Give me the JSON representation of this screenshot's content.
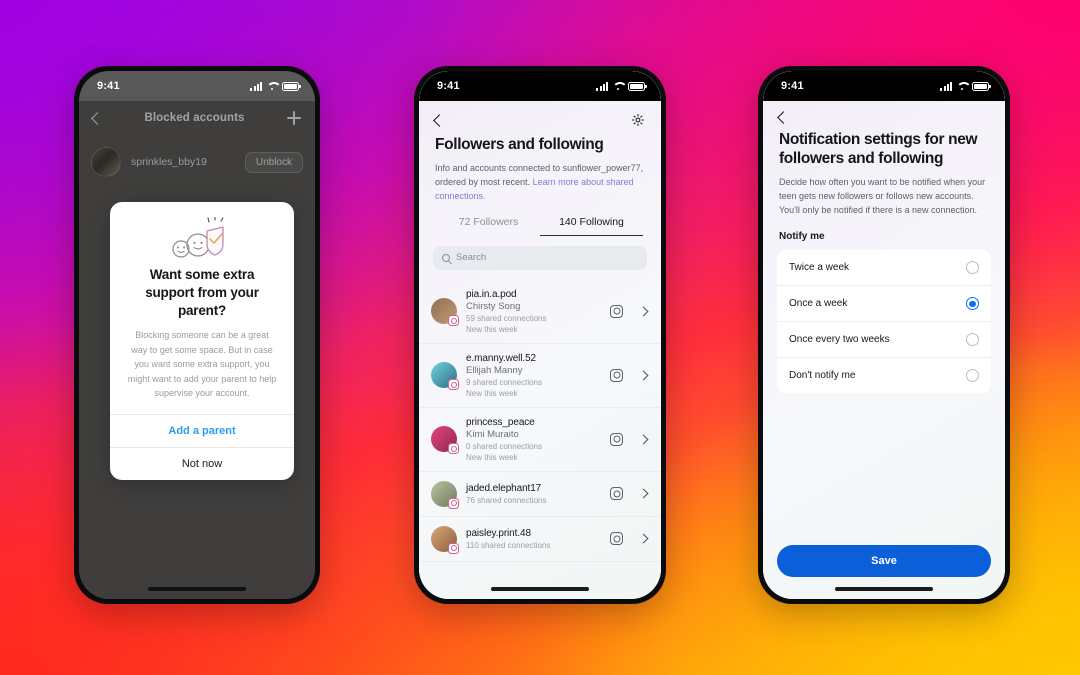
{
  "background": {
    "gradient_colors": [
      "#9b13e0",
      "#d5119b",
      "#ff2d3d",
      "#ff7a16",
      "#ffc400"
    ]
  },
  "accent": {
    "instagram_blue": "#0b5fd9",
    "link_blue": "#2b9cf0",
    "lavender_link": "#7b7fd1"
  },
  "phones": [
    {
      "id": "blocked-accounts",
      "status_bar": {
        "time": "9:41"
      },
      "nav": {
        "back": "back-chevron",
        "title": "Blocked accounts",
        "add": "plus-icon"
      },
      "blocked_row": {
        "username": "sprinkles_bby19",
        "action_label": "Unblock"
      },
      "dialog": {
        "illustration": "faces-with-shield-illustration",
        "heading": "Want some extra support from your parent?",
        "body": "Blocking someone can be a great way to get some space. But in case you want some extra support, you might want to add your parent to help supervise your account.",
        "primary_label": "Add a parent",
        "secondary_label": "Not now"
      }
    },
    {
      "id": "followers-and-following",
      "status_bar": {
        "time": "9:41"
      },
      "topbar": {
        "back": "back-chevron",
        "settings": "gear-icon"
      },
      "title": "Followers and following",
      "subtitle": "Info and accounts connected to sunflower_power77, ordered by most recent.",
      "link": "Learn more about shared connections.",
      "tabs": [
        {
          "label": "72 Followers",
          "active": false
        },
        {
          "label": "140 Following",
          "active": true
        }
      ],
      "search": {
        "placeholder": "Search"
      },
      "accounts": [
        {
          "username": "pia.in.a.pod",
          "name": "Chirsty Song",
          "connections": "59 shared connections",
          "note": "New this week",
          "avatar_colors": [
            "#8f6f52",
            "#c49a78"
          ]
        },
        {
          "username": "e.manny.well.52",
          "name": "Ellijah Manny",
          "connections": "9 shared connections",
          "note": "New this week",
          "avatar_colors": [
            "#6fd3e0",
            "#2f6d82"
          ]
        },
        {
          "username": "princess_peace",
          "name": "Kimi Muraito",
          "connections": "0 shared connections",
          "note": "New this week",
          "avatar_colors": [
            "#e8437f",
            "#8a2b4e"
          ]
        },
        {
          "username": "jaded.elephant17",
          "name": "",
          "connections": "76 shared connections",
          "note": "",
          "avatar_colors": [
            "#b9c4a4",
            "#6f7a5e"
          ]
        },
        {
          "username": "paisley.print.48",
          "name": "",
          "connections": "110 shared connections",
          "note": "",
          "avatar_colors": [
            "#d9a87a",
            "#8a5d3b"
          ]
        }
      ]
    },
    {
      "id": "notification-settings",
      "status_bar": {
        "time": "9:41"
      },
      "topbar": {
        "back": "back-chevron"
      },
      "title": "Notification settings for new followers and following",
      "subtitle": "Decide how often you want to be notified when your teen gets new followers or follows new accounts. You'll only be notified if there is a new connection.",
      "section_label": "Notify me",
      "options": [
        {
          "label": "Twice a week",
          "selected": false
        },
        {
          "label": "Once a week",
          "selected": true
        },
        {
          "label": "Once every two weeks",
          "selected": false
        },
        {
          "label": "Don't notify me",
          "selected": false
        }
      ],
      "save_label": "Save"
    }
  ]
}
